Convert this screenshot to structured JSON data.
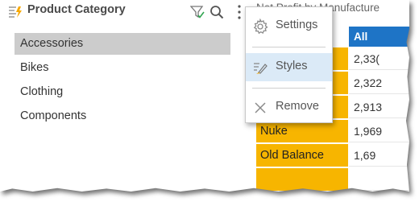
{
  "panel": {
    "title": "Product Category",
    "items": [
      {
        "label": "Accessories",
        "selected": true
      },
      {
        "label": "Bikes",
        "selected": false
      },
      {
        "label": "Clothing",
        "selected": false
      },
      {
        "label": "Components",
        "selected": false
      }
    ]
  },
  "table": {
    "title": "Net Profit by Manufacture",
    "header": "All",
    "rows": [
      {
        "name": "",
        "value": "2,33("
      },
      {
        "name": "",
        "value": "2,322"
      },
      {
        "name": "",
        "value": "2,913"
      },
      {
        "name": "Nuke",
        "value": "1,969"
      },
      {
        "name": "Old Balance",
        "value": "1,69"
      },
      {
        "name": "",
        "value": ""
      }
    ]
  },
  "menu": {
    "items": [
      {
        "label": "Settings",
        "icon": "gear-icon"
      },
      {
        "label": "Styles",
        "icon": "paint-brush-icon"
      },
      {
        "label": "Remove",
        "icon": "x-icon"
      }
    ],
    "active": "Styles"
  },
  "colors": {
    "header_blue": "#1e74c6",
    "category_gold": "#f7b500",
    "selected_gray": "#cccccc",
    "menu_active": "#dbeaf7"
  }
}
